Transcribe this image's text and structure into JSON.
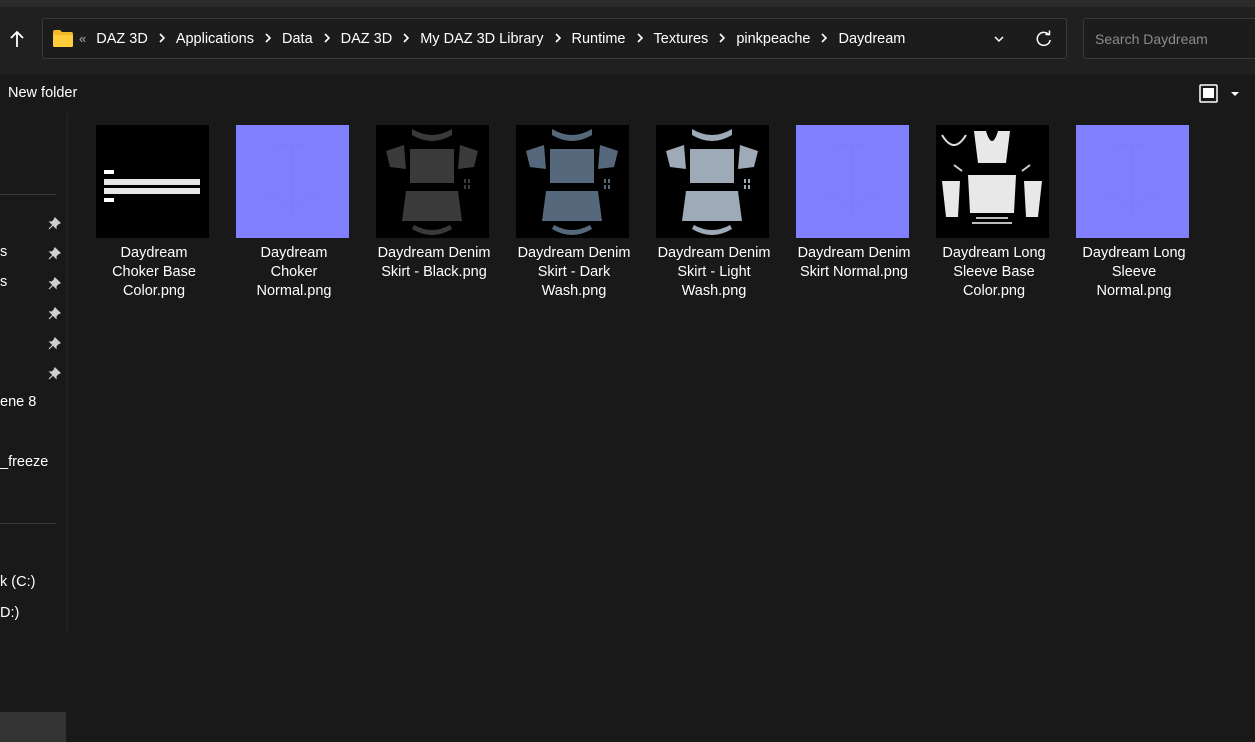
{
  "address": {
    "back_marker": "«",
    "crumbs": [
      "DAZ 3D",
      "Applications",
      "Data",
      "DAZ 3D",
      "My DAZ 3D Library",
      "Runtime",
      "Textures",
      "pinkpeache",
      "Daydream"
    ]
  },
  "search": {
    "placeholder": "Search Daydream"
  },
  "toolbar": {
    "new_folder": "New folder"
  },
  "nav": {
    "items": [
      {
        "label": "s"
      },
      {
        "label": "s"
      },
      {
        "label": "ene 8"
      },
      {
        "label": "_freeze"
      },
      {
        "label": "k (C:)"
      },
      {
        "label": "D:)"
      }
    ]
  },
  "files": [
    {
      "name": "Daydream Choker Base Color.png",
      "lines": [
        "Daydream",
        "Choker Base",
        "Color.png"
      ],
      "kind": "choker-color"
    },
    {
      "name": "Daydream Choker Normal.png",
      "lines": [
        "Daydream",
        "Choker",
        "Normal.png"
      ],
      "kind": "normal"
    },
    {
      "name": "Daydream Denim Skirt - Black.png",
      "lines": [
        "Daydream Denim",
        "Skirt - Black.png"
      ],
      "kind": "skirt-black"
    },
    {
      "name": "Daydream Denim Skirt - Dark Wash.png",
      "lines": [
        "Daydream Denim",
        "Skirt - Dark",
        "Wash.png"
      ],
      "kind": "skirt-dark"
    },
    {
      "name": "Daydream Denim Skirt - Light Wash.png",
      "lines": [
        "Daydream Denim",
        "Skirt - Light",
        "Wash.png"
      ],
      "kind": "skirt-light"
    },
    {
      "name": "Daydream Denim Skirt Normal.png",
      "lines": [
        "Daydream Denim",
        "Skirt Normal.png"
      ],
      "kind": "normal"
    },
    {
      "name": "Daydream Long Sleeve Base Color.png",
      "lines": [
        "Daydream Long",
        "Sleeve Base",
        "Color.png"
      ],
      "kind": "sleeve-color"
    },
    {
      "name": "Daydream Long Sleeve Normal.png",
      "lines": [
        "Daydream Long",
        "Sleeve",
        "Normal.png"
      ],
      "kind": "normal"
    }
  ],
  "colors": {
    "normal_map": "#8080ff",
    "skirt_black": "#3a3a3a",
    "skirt_dark": "#56687c",
    "skirt_light": "#9eaab6"
  }
}
